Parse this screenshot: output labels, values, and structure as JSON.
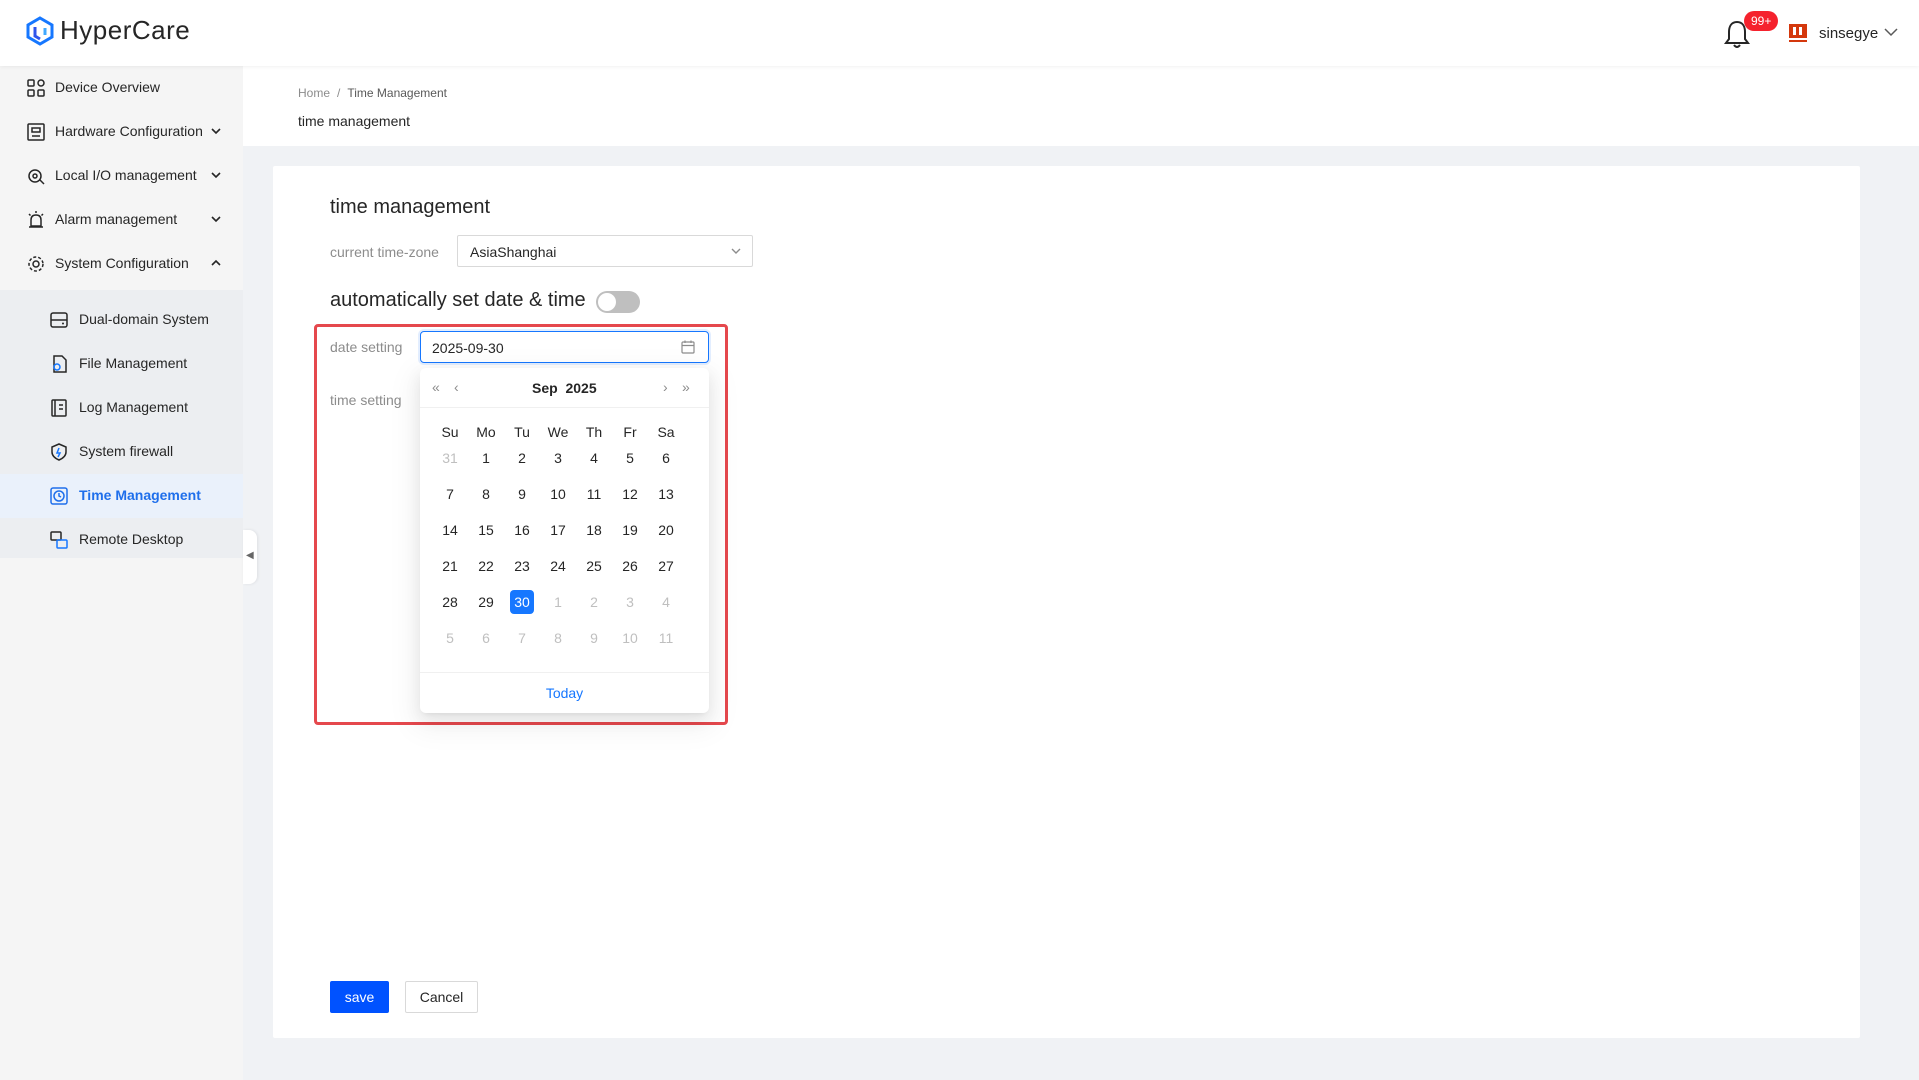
{
  "app": {
    "name": "HyperCare"
  },
  "header": {
    "badge": "99+",
    "username": "sinsegye"
  },
  "sidebar": {
    "items": [
      {
        "label": "Device Overview",
        "icon": "grid-icon"
      },
      {
        "label": "Hardware Configuration",
        "icon": "hardware-icon"
      },
      {
        "label": "Local I/O management",
        "icon": "io-icon"
      },
      {
        "label": "Alarm management",
        "icon": "alarm-icon"
      },
      {
        "label": "System Configuration",
        "icon": "system-config-icon"
      }
    ],
    "sub_items": [
      {
        "label": "Dual-domain System",
        "icon": "server-icon"
      },
      {
        "label": "File Management",
        "icon": "file-gear-icon"
      },
      {
        "label": "Log Management",
        "icon": "log-icon"
      },
      {
        "label": "System firewall",
        "icon": "shield-icon"
      },
      {
        "label": "Time Management",
        "icon": "clock-icon",
        "active": true
      },
      {
        "label": "Remote Desktop",
        "icon": "remote-desktop-icon"
      }
    ]
  },
  "breadcrumb": {
    "home": "Home",
    "current": "Time Management",
    "separator": "/"
  },
  "page": {
    "title": "time management"
  },
  "form": {
    "section_title": "time management",
    "timezone_label": "current time-zone",
    "timezone_value": "AsiaShanghai",
    "auto_title": "automatically set date & time",
    "auto_enabled": false,
    "date_label": "date setting",
    "date_value": "2025-09-30",
    "time_label": "time setting"
  },
  "calendar": {
    "month": "Sep",
    "year": "2025",
    "weekdays": [
      "Su",
      "Mo",
      "Tu",
      "We",
      "Th",
      "Fr",
      "Sa"
    ],
    "weeks": [
      [
        "31",
        "1",
        "2",
        "3",
        "4",
        "5",
        "6"
      ],
      [
        "7",
        "8",
        "9",
        "10",
        "11",
        "12",
        "13"
      ],
      [
        "14",
        "15",
        "16",
        "17",
        "18",
        "19",
        "20"
      ],
      [
        "21",
        "22",
        "23",
        "24",
        "25",
        "26",
        "27"
      ],
      [
        "28",
        "29",
        "30",
        "1",
        "2",
        "3",
        "4"
      ],
      [
        "5",
        "6",
        "7",
        "8",
        "9",
        "10",
        "11"
      ]
    ],
    "selected": "30",
    "today_label": "Today"
  },
  "buttons": {
    "save": "save",
    "cancel": "Cancel"
  },
  "colors": {
    "primary": "#0052ff",
    "accent": "#1677ff",
    "highlight": "#e5484d",
    "badge": "#f5222d"
  }
}
